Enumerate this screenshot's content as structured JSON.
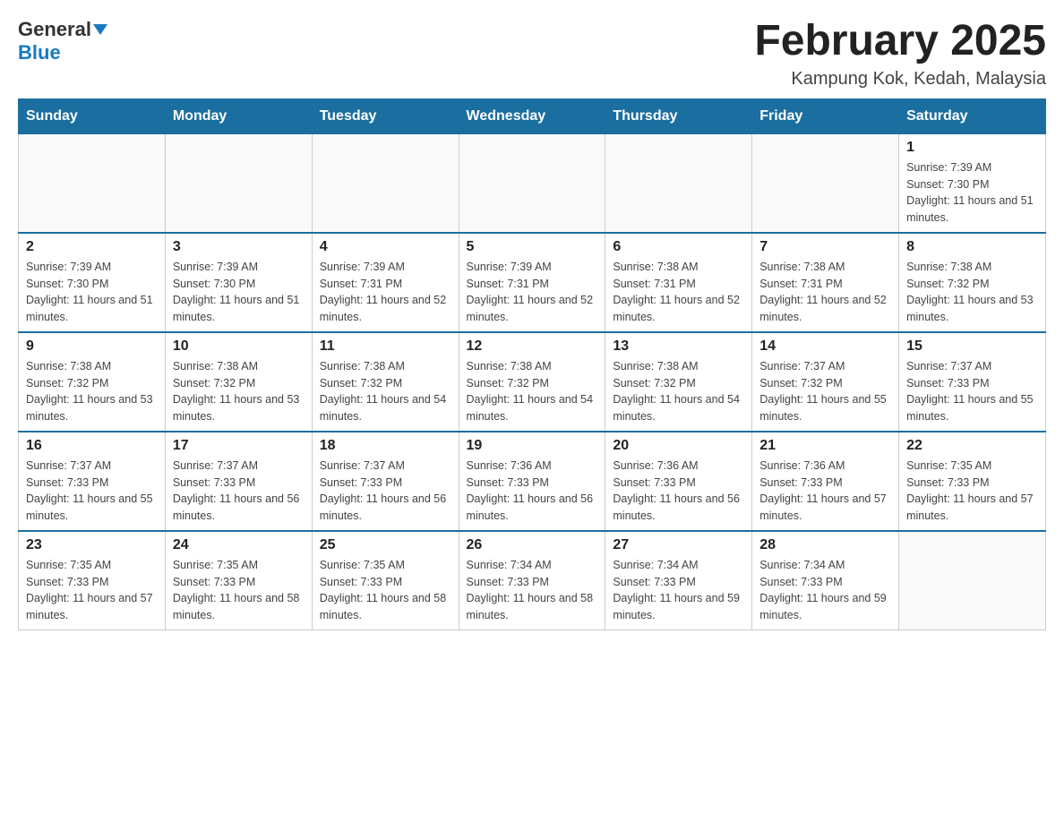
{
  "header": {
    "logo_general": "General",
    "logo_blue": "Blue",
    "month_title": "February 2025",
    "location": "Kampung Kok, Kedah, Malaysia"
  },
  "days_of_week": [
    "Sunday",
    "Monday",
    "Tuesday",
    "Wednesday",
    "Thursday",
    "Friday",
    "Saturday"
  ],
  "weeks": [
    [
      {
        "day": "",
        "info": ""
      },
      {
        "day": "",
        "info": ""
      },
      {
        "day": "",
        "info": ""
      },
      {
        "day": "",
        "info": ""
      },
      {
        "day": "",
        "info": ""
      },
      {
        "day": "",
        "info": ""
      },
      {
        "day": "1",
        "info": "Sunrise: 7:39 AM\nSunset: 7:30 PM\nDaylight: 11 hours and 51 minutes."
      }
    ],
    [
      {
        "day": "2",
        "info": "Sunrise: 7:39 AM\nSunset: 7:30 PM\nDaylight: 11 hours and 51 minutes."
      },
      {
        "day": "3",
        "info": "Sunrise: 7:39 AM\nSunset: 7:30 PM\nDaylight: 11 hours and 51 minutes."
      },
      {
        "day": "4",
        "info": "Sunrise: 7:39 AM\nSunset: 7:31 PM\nDaylight: 11 hours and 52 minutes."
      },
      {
        "day": "5",
        "info": "Sunrise: 7:39 AM\nSunset: 7:31 PM\nDaylight: 11 hours and 52 minutes."
      },
      {
        "day": "6",
        "info": "Sunrise: 7:38 AM\nSunset: 7:31 PM\nDaylight: 11 hours and 52 minutes."
      },
      {
        "day": "7",
        "info": "Sunrise: 7:38 AM\nSunset: 7:31 PM\nDaylight: 11 hours and 52 minutes."
      },
      {
        "day": "8",
        "info": "Sunrise: 7:38 AM\nSunset: 7:32 PM\nDaylight: 11 hours and 53 minutes."
      }
    ],
    [
      {
        "day": "9",
        "info": "Sunrise: 7:38 AM\nSunset: 7:32 PM\nDaylight: 11 hours and 53 minutes."
      },
      {
        "day": "10",
        "info": "Sunrise: 7:38 AM\nSunset: 7:32 PM\nDaylight: 11 hours and 53 minutes."
      },
      {
        "day": "11",
        "info": "Sunrise: 7:38 AM\nSunset: 7:32 PM\nDaylight: 11 hours and 54 minutes."
      },
      {
        "day": "12",
        "info": "Sunrise: 7:38 AM\nSunset: 7:32 PM\nDaylight: 11 hours and 54 minutes."
      },
      {
        "day": "13",
        "info": "Sunrise: 7:38 AM\nSunset: 7:32 PM\nDaylight: 11 hours and 54 minutes."
      },
      {
        "day": "14",
        "info": "Sunrise: 7:37 AM\nSunset: 7:32 PM\nDaylight: 11 hours and 55 minutes."
      },
      {
        "day": "15",
        "info": "Sunrise: 7:37 AM\nSunset: 7:33 PM\nDaylight: 11 hours and 55 minutes."
      }
    ],
    [
      {
        "day": "16",
        "info": "Sunrise: 7:37 AM\nSunset: 7:33 PM\nDaylight: 11 hours and 55 minutes."
      },
      {
        "day": "17",
        "info": "Sunrise: 7:37 AM\nSunset: 7:33 PM\nDaylight: 11 hours and 56 minutes."
      },
      {
        "day": "18",
        "info": "Sunrise: 7:37 AM\nSunset: 7:33 PM\nDaylight: 11 hours and 56 minutes."
      },
      {
        "day": "19",
        "info": "Sunrise: 7:36 AM\nSunset: 7:33 PM\nDaylight: 11 hours and 56 minutes."
      },
      {
        "day": "20",
        "info": "Sunrise: 7:36 AM\nSunset: 7:33 PM\nDaylight: 11 hours and 56 minutes."
      },
      {
        "day": "21",
        "info": "Sunrise: 7:36 AM\nSunset: 7:33 PM\nDaylight: 11 hours and 57 minutes."
      },
      {
        "day": "22",
        "info": "Sunrise: 7:35 AM\nSunset: 7:33 PM\nDaylight: 11 hours and 57 minutes."
      }
    ],
    [
      {
        "day": "23",
        "info": "Sunrise: 7:35 AM\nSunset: 7:33 PM\nDaylight: 11 hours and 57 minutes."
      },
      {
        "day": "24",
        "info": "Sunrise: 7:35 AM\nSunset: 7:33 PM\nDaylight: 11 hours and 58 minutes."
      },
      {
        "day": "25",
        "info": "Sunrise: 7:35 AM\nSunset: 7:33 PM\nDaylight: 11 hours and 58 minutes."
      },
      {
        "day": "26",
        "info": "Sunrise: 7:34 AM\nSunset: 7:33 PM\nDaylight: 11 hours and 58 minutes."
      },
      {
        "day": "27",
        "info": "Sunrise: 7:34 AM\nSunset: 7:33 PM\nDaylight: 11 hours and 59 minutes."
      },
      {
        "day": "28",
        "info": "Sunrise: 7:34 AM\nSunset: 7:33 PM\nDaylight: 11 hours and 59 minutes."
      },
      {
        "day": "",
        "info": ""
      }
    ]
  ]
}
